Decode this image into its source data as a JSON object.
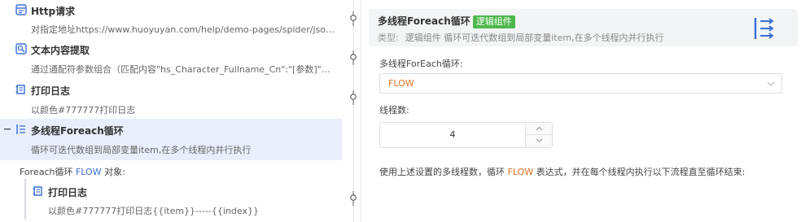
{
  "flow": {
    "nodes": [
      {
        "title": "Http请求",
        "desc": "对指定地址https://www.huoyuyan.com/help/demo-pages/spider/json.html发送GET请求"
      },
      {
        "title": "文本内容提取",
        "desc": "通过通配符参数组合（匹配内容\"hs_Character_Fullname_Cn\":\"[参数]\"）提取内容"
      },
      {
        "title": "打印日志",
        "desc": "以颜色#777777打印日志"
      },
      {
        "title": "多线程Foreach循环",
        "desc": "循环可迭代数组到局部变量item,在多个线程内并行执行"
      }
    ],
    "foreach_prefix": "Foreach循环",
    "foreach_kw": "FLOW",
    "foreach_suffix": "对象:",
    "child": {
      "title": "打印日志",
      "desc": "以颜色#777777打印日志{{item}}-----{{index}}"
    }
  },
  "detail": {
    "title": "多线程Foreach循环",
    "badge": "逻辑组件",
    "type_label": "类型:",
    "type_value": "逻辑组件 循环可迭代数组到局部变量item,在多个线程内并行执行",
    "field1_label": "多线程ForEach循环:",
    "field1_value": "FLOW",
    "field2_label": "线程数:",
    "field2_value": "4",
    "note_prefix": "使用上述设置的多线程数，循环",
    "note_kw": "FLOW",
    "note_suffix": "表达式，并在每个线程内执行以下流程直至循环结束:"
  },
  "colors": {
    "accent": "#3a6fd8",
    "badge": "#4cb84c",
    "highlight": "#e0701f",
    "active_bg": "#e8eefb"
  },
  "icons": [
    "http-icon",
    "extract-icon",
    "log-icon",
    "foreach-icon",
    "collapse-icon",
    "connector-icon",
    "chevron-down-icon",
    "chevron-up-icon"
  ]
}
